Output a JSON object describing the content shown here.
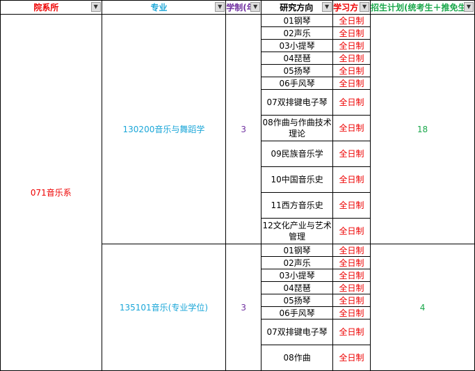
{
  "headers": [
    "院系所",
    "专业",
    "学制(年",
    "研究方向",
    "学习方",
    "招生计划(统考生＋推免生"
  ],
  "department": "071音乐系",
  "groups": [
    {
      "major": "130200音乐与舞蹈学",
      "years": "3",
      "plan": "18",
      "directions": [
        "01钢琴",
        "02声乐",
        "03小提琴",
        "04琵琶",
        "05扬琴",
        "06手风琴",
        "07双排键电子琴",
        "08作曲与作曲技术理论",
        "09民族音乐学",
        "10中国音乐史",
        "11西方音乐史",
        "12文化产业与艺术管理"
      ]
    },
    {
      "major": "135101音乐(专业学位)",
      "years": "3",
      "plan": "4",
      "directions": [
        "01钢琴",
        "02声乐",
        "03小提琴",
        "04琵琶",
        "05扬琴",
        "06手风琴",
        "07双排键电子琴",
        "08作曲"
      ]
    }
  ],
  "study_mode": "全日制",
  "filter_icon": "filter-dropdown-icon"
}
